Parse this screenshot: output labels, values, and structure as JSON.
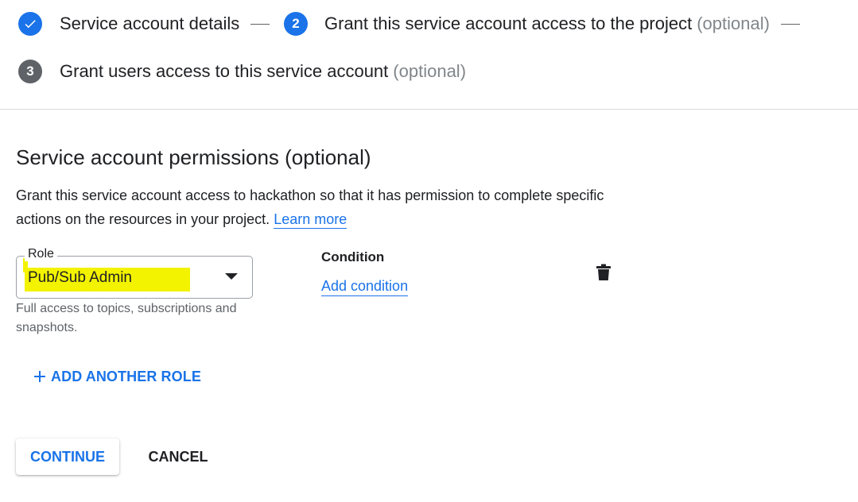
{
  "stepper": {
    "step1": {
      "label": "Service account details",
      "state": "done"
    },
    "step2": {
      "number": "2",
      "label": "Grant this service account access to the project",
      "optional": "(optional)",
      "state": "active"
    },
    "step3": {
      "number": "3",
      "label": "Grant users access to this service account",
      "optional": "(optional)",
      "state": "pending"
    }
  },
  "section": {
    "title": "Service account permissions (optional)",
    "description": "Grant this service account access to hackathon so that it has permission to complete specific actions on the resources in your project.",
    "learn_more": "Learn more"
  },
  "role": {
    "label": "Role",
    "value": "Pub/Sub Admin",
    "hint": "Full access to topics, subscriptions and snapshots."
  },
  "condition": {
    "label": "Condition",
    "add_link": "Add condition"
  },
  "add_role": {
    "label": "ADD ANOTHER ROLE"
  },
  "actions": {
    "continue": "CONTINUE",
    "cancel": "CANCEL"
  },
  "colors": {
    "accent": "#1a73e8",
    "highlight": "#f3f300",
    "muted": "#5f6368"
  }
}
